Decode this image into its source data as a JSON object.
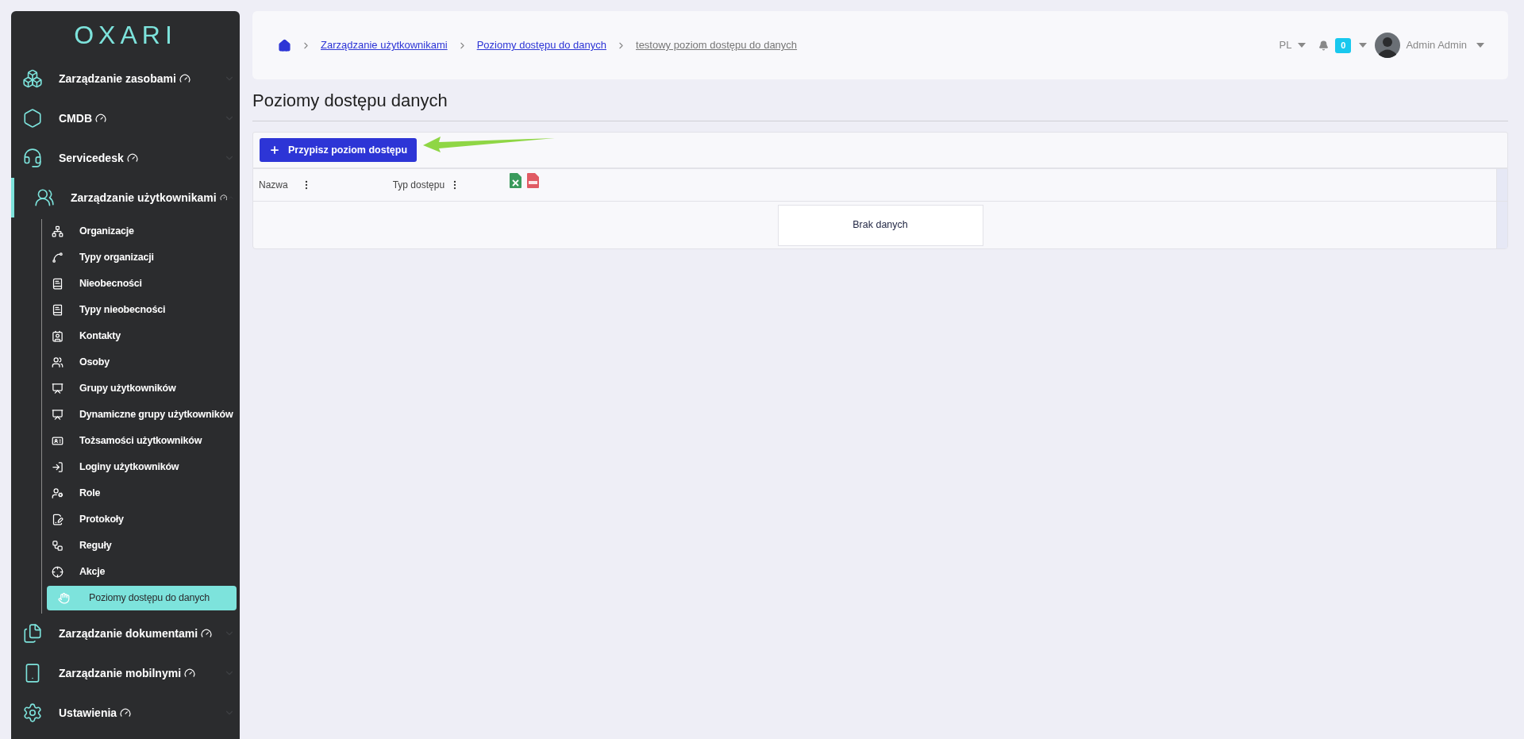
{
  "logo": "OXARI",
  "sidebar": {
    "items": [
      {
        "label": "Zarządzanie zasobami",
        "expanded": false
      },
      {
        "label": "CMDB",
        "expanded": false
      },
      {
        "label": "Servicedesk",
        "expanded": false
      },
      {
        "label": "Zarządzanie użytkownikami",
        "expanded": true,
        "children": [
          {
            "label": "Organizacje",
            "selected": false
          },
          {
            "label": "Typy organizacji",
            "selected": false
          },
          {
            "label": "Nieobecności",
            "selected": false
          },
          {
            "label": "Typy nieobecności",
            "selected": false
          },
          {
            "label": "Kontakty",
            "selected": false
          },
          {
            "label": "Osoby",
            "selected": false
          },
          {
            "label": "Grupy użytkowników",
            "selected": false
          },
          {
            "label": "Dynamiczne grupy użytkowników",
            "selected": false
          },
          {
            "label": "Tożsamości użytkowników",
            "selected": false
          },
          {
            "label": "Loginy użytkowników",
            "selected": false
          },
          {
            "label": "Role",
            "selected": false
          },
          {
            "label": "Protokoły",
            "selected": false
          },
          {
            "label": "Reguły",
            "selected": false
          },
          {
            "label": "Akcje",
            "selected": false
          },
          {
            "label": "Poziomy dostępu do danych",
            "selected": true
          }
        ]
      },
      {
        "label": "Zarządzanie dokumentami",
        "expanded": false
      },
      {
        "label": "Zarządzanie mobilnymi",
        "expanded": false
      },
      {
        "label": "Ustawienia",
        "expanded": false
      }
    ]
  },
  "breadcrumbs": [
    {
      "label": "Zarządzanie użytkownikami",
      "current": false
    },
    {
      "label": "Poziomy dostępu do danych",
      "current": false
    },
    {
      "label": "testowy poziom dostępu do danych",
      "current": true
    }
  ],
  "header": {
    "language": "PL",
    "notifications": "0",
    "user": "Admin Admin"
  },
  "page_title": "Poziomy dostępu danych",
  "toolbar": {
    "add_button": "Przypisz poziom dostępu"
  },
  "table": {
    "columns": [
      "Nazwa",
      "Typ dostępu"
    ],
    "empty_message": "Brak danych"
  }
}
